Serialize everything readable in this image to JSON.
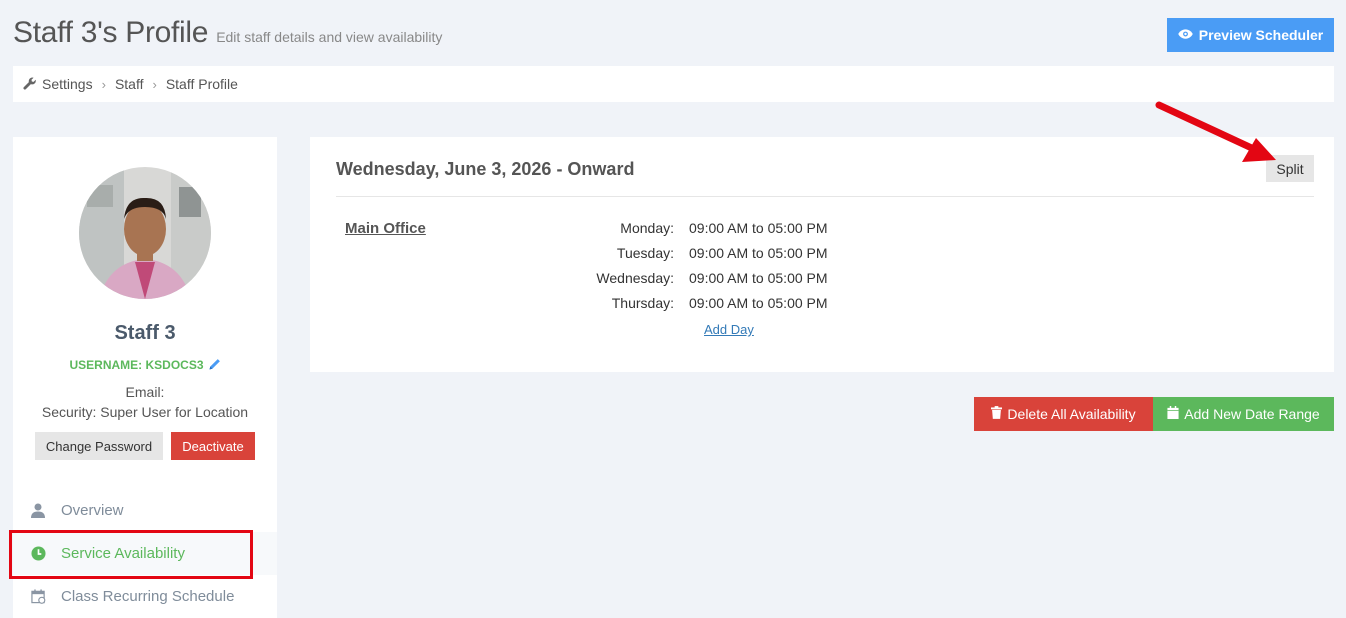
{
  "header": {
    "title": "Staff 3's Profile",
    "subtitle": "Edit staff details and view availability",
    "preview_button": "Preview Scheduler"
  },
  "breadcrumb": [
    "Settings",
    "Staff",
    "Staff Profile"
  ],
  "profile": {
    "name": "Staff 3",
    "username": "USERNAME: KSDOCS3",
    "email": "Email:",
    "security": "Security: Super User for Location",
    "change_password": "Change Password",
    "deactivate": "Deactivate"
  },
  "nav": [
    {
      "label": "Overview",
      "icon": "user-icon"
    },
    {
      "label": "Service Availability",
      "icon": "clock-icon",
      "active": true
    },
    {
      "label": "Class Recurring Schedule",
      "icon": "calendar-icon"
    }
  ],
  "availability": {
    "title": "Wednesday, June 3, 2026 - Onward",
    "split_label": "Split",
    "location": "Main Office",
    "schedule": [
      {
        "day": "Monday:",
        "time": "09:00 AM to 05:00 PM"
      },
      {
        "day": "Tuesday:",
        "time": "09:00 AM to 05:00 PM"
      },
      {
        "day": "Wednesday:",
        "time": "09:00 AM to 05:00 PM"
      },
      {
        "day": "Thursday:",
        "time": "09:00 AM to 05:00 PM"
      }
    ],
    "add_day": "Add Day"
  },
  "actions": {
    "delete_all": "Delete All Availability",
    "add_range": "Add New Date Range"
  },
  "colors": {
    "primary": "#4a9cf5",
    "danger": "#d9433a",
    "success": "#5cb85c",
    "annotation": "#e30613"
  }
}
